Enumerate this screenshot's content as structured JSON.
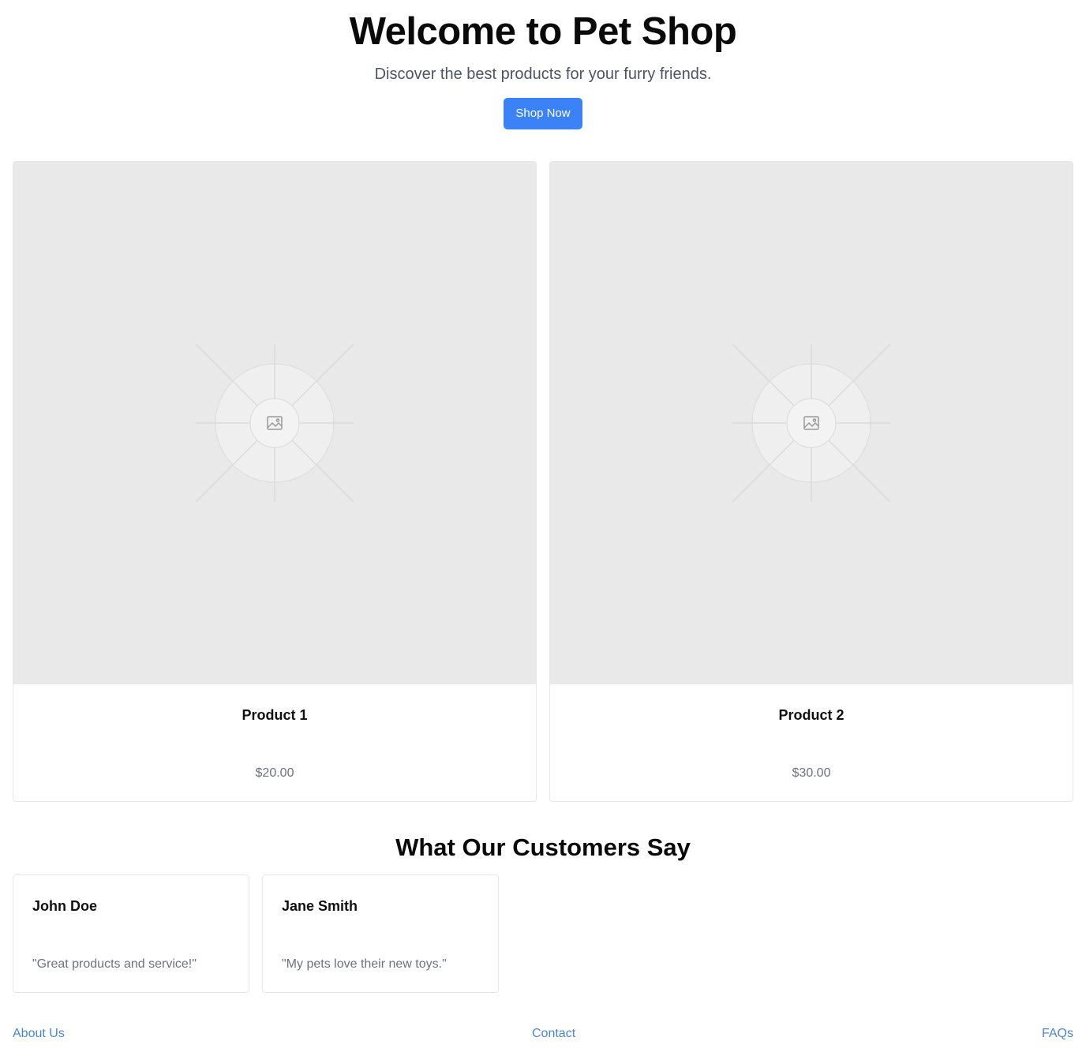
{
  "hero": {
    "title": "Welcome to Pet Shop",
    "subtitle": "Discover the best products for your furry friends.",
    "button_label": "Shop Now"
  },
  "products": [
    {
      "name": "Product 1",
      "price": "$20.00",
      "image_icon": "image-placeholder-icon"
    },
    {
      "name": "Product 2",
      "price": "$30.00",
      "image_icon": "image-placeholder-icon"
    }
  ],
  "testimonials": {
    "title": "What Our Customers Say",
    "items": [
      {
        "name": "John Doe",
        "quote": "\"Great products and service!\""
      },
      {
        "name": "Jane Smith",
        "quote": "\"My pets love their new toys.\""
      }
    ]
  },
  "footer": {
    "links": [
      "About Us",
      "Contact",
      "FAQs"
    ]
  },
  "colors": {
    "accent": "#3b82f6",
    "link": "#4a86d4",
    "image_placeholder_bg": "#e9e9e9",
    "muted_text": "#6b7280"
  }
}
